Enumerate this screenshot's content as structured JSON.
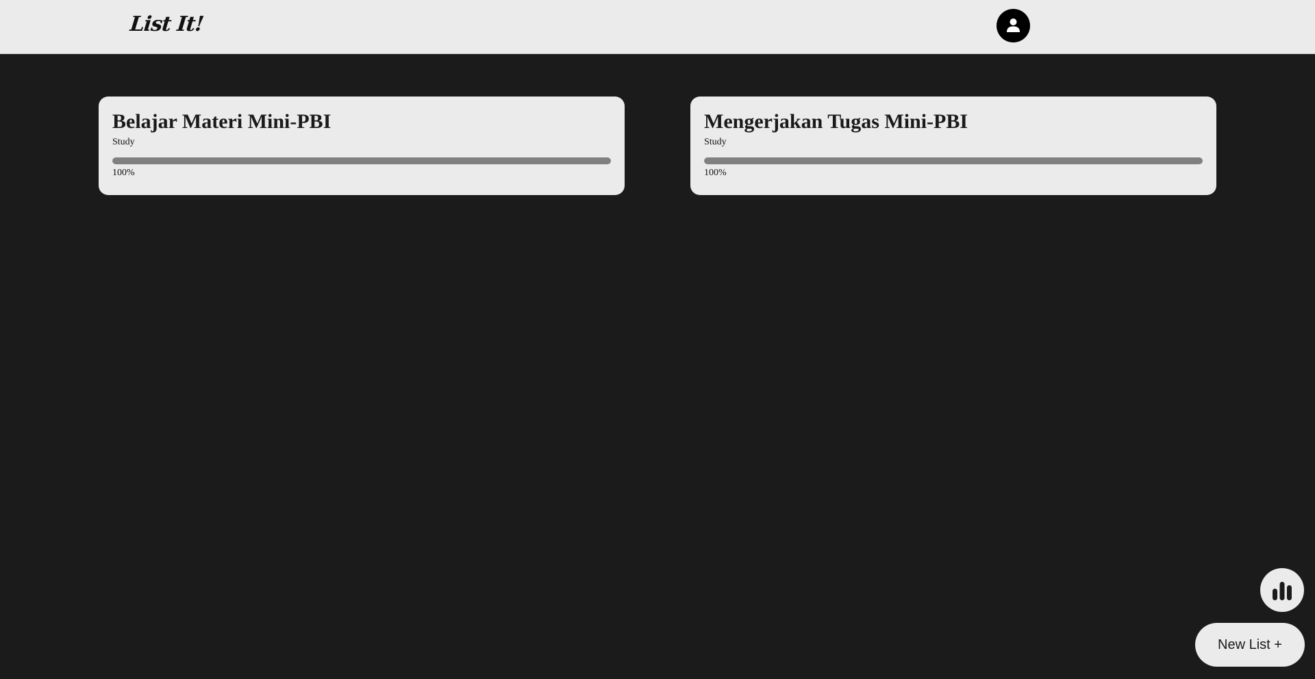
{
  "header": {
    "logo": "List It!",
    "avatar_icon": "user-icon"
  },
  "cards": [
    {
      "title": "Belajar Materi Mini-PBI",
      "category": "Study",
      "progress": 100,
      "progress_label": "100%"
    },
    {
      "title": "Mengerjakan Tugas Mini-PBI",
      "category": "Study",
      "progress": 100,
      "progress_label": "100%"
    }
  ],
  "actions": {
    "stats_icon": "bar-chart-icon",
    "new_list_label": "New List +"
  },
  "colors": {
    "background": "#1b1b1b",
    "surface": "#ebebeb",
    "progress_fill": "#808080"
  }
}
